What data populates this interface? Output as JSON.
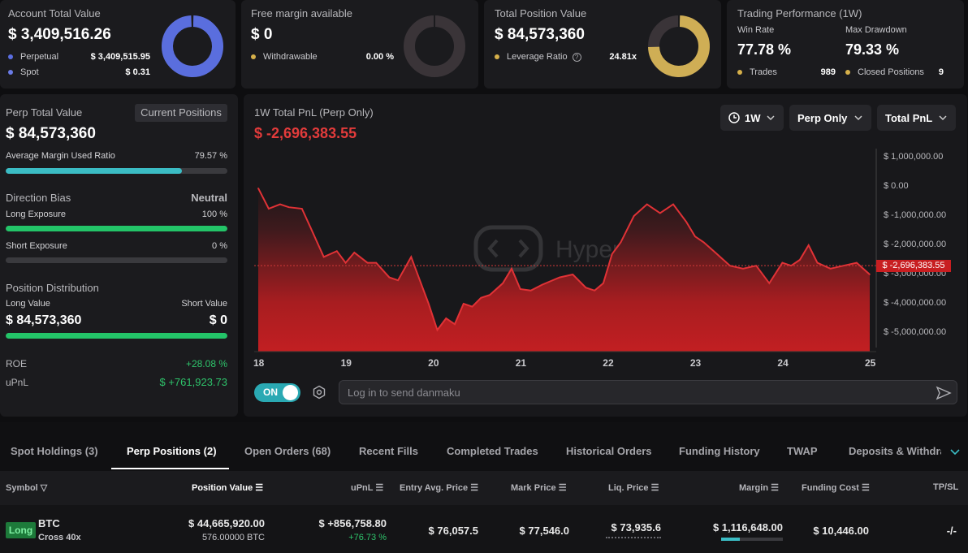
{
  "cards": {
    "account": {
      "title": "Account Total Value",
      "value": "$ 3,409,516.26",
      "rows": [
        {
          "label": "Perpetual",
          "value": "$ 3,409,515.95",
          "color": "#5b6ee1"
        },
        {
          "label": "Spot",
          "value": "$ 0.31",
          "color": "#6a7be6"
        }
      ],
      "donut_fraction": 1.0,
      "donut_color": "#5a6ede"
    },
    "margin": {
      "title": "Free margin available",
      "value": "$ 0",
      "row_label": "Withdrawable",
      "row_value": "0.00 %",
      "dot_color": "#d6b04a",
      "donut_fraction": 0.0,
      "donut_color": "#d6b04a"
    },
    "position": {
      "title": "Total Position Value",
      "value": "$ 84,573,360",
      "row_label": "Leverage Ratio",
      "row_icon": "help-icon",
      "row_value": "24.81x",
      "dot_color": "#d6b04a",
      "donut_fraction": 0.75,
      "donut_color": "#cfae55"
    },
    "performance": {
      "title": "Trading Performance (1W)",
      "win_rate_label": "Win Rate",
      "win_rate": "77.78 %",
      "drawdown_label": "Max Drawdown",
      "drawdown": "79.33 %",
      "trades_label": "Trades",
      "trades": "989",
      "closed_label": "Closed Positions",
      "closed": "9",
      "dot_color": "#d6b04a"
    }
  },
  "left": {
    "perp_title": "Perp Total Value",
    "positions_button": "Current Positions",
    "perp_value": "$ 84,573,360",
    "margin_ratio_label": "Average Margin Used Ratio",
    "margin_ratio_value": "79.57 %",
    "margin_ratio_fraction": 0.7957,
    "direction_title": "Direction Bias",
    "direction_value": "Neutral",
    "long_label": "Long Exposure",
    "long_value": "100 %",
    "long_fraction": 1.0,
    "short_label": "Short Exposure",
    "short_value": "0 %",
    "short_fraction": 0.0,
    "distribution_title": "Position Distribution",
    "long_value_label": "Long Value",
    "short_value_label": "Short Value",
    "long_amount": "$ 84,573,360",
    "short_amount": "$ 0",
    "distribution_long_fraction": 1.0,
    "roe_label": "ROE",
    "roe_value": "+28.08 %",
    "upnl_label": "uPnL",
    "upnl_value": "$ +761,923.73",
    "green": "#23c468",
    "teal": "#3bbcc4"
  },
  "chart_panel": {
    "title": "1W Total PnL (Perp Only)",
    "value": "$ -2,696,383.55",
    "period": "1W",
    "period_icon": "clock-icon",
    "scope": "Perp Only",
    "metric": "Total PnL",
    "watermark": "Hyperbot",
    "toggle": "ON",
    "danmaku_placeholder": "Log in to send danmaku",
    "settings_icon": "hexagon-gear-icon",
    "send_icon": "send-icon",
    "current_label": "$ -2,696,383.55"
  },
  "chart_data": {
    "type": "area",
    "x_ticks": [
      "18",
      "19",
      "20",
      "21",
      "22",
      "23",
      "24",
      "25"
    ],
    "y_ticks": [
      "$ 1,000,000.00",
      "$ 0.00",
      "$ -1,000,000.00",
      "$ -2,000,000.00",
      "$ -3,000,000.00",
      "$ -4,000,000.00",
      "$ -5,000,000.00"
    ],
    "ylim": [
      -5000000,
      1000000
    ],
    "current_value": -2696383.55,
    "series": [
      {
        "x": [
          18.0,
          18.12,
          18.25,
          18.35,
          18.5,
          18.6,
          18.75,
          18.9,
          19.0,
          19.1,
          19.25,
          19.35,
          19.5,
          19.6,
          19.75,
          19.85,
          19.95,
          20.05,
          20.15,
          20.25,
          20.35,
          20.45,
          20.55,
          20.65,
          20.8,
          20.9,
          21.0,
          21.12,
          21.25,
          21.45,
          21.6,
          21.75,
          21.85,
          21.95,
          22.05,
          22.15,
          22.3,
          22.45,
          22.6,
          22.75,
          22.9,
          23.0,
          23.1,
          23.25,
          23.4,
          23.55,
          23.7,
          23.85,
          24.0,
          24.1,
          24.2,
          24.3,
          24.4,
          24.55,
          24.7,
          24.85,
          25.0
        ],
        "values": [
          -50000,
          -750000,
          -600000,
          -700000,
          -750000,
          -1400000,
          -2400000,
          -2200000,
          -2600000,
          -2250000,
          -2600000,
          -2600000,
          -3100000,
          -3200000,
          -2400000,
          -3200000,
          -4000000,
          -4900000,
          -4500000,
          -4700000,
          -4000000,
          -4100000,
          -3800000,
          -3700000,
          -3300000,
          -2800000,
          -3500000,
          -3550000,
          -3350000,
          -3100000,
          -3000000,
          -3450000,
          -3550000,
          -3300000,
          -2300000,
          -1900000,
          -1000000,
          -600000,
          -900000,
          -600000,
          -1200000,
          -1700000,
          -1900000,
          -2300000,
          -2700000,
          -2800000,
          -2700000,
          -3300000,
          -2600000,
          -2700000,
          -2500000,
          -2000000,
          -2600000,
          -2800000,
          -2700000,
          -2600000,
          -3000000
        ]
      }
    ],
    "grid": false
  },
  "tabs": [
    "Spot Holdings (3)",
    "Perp Positions (2)",
    "Open Orders (68)",
    "Recent Fills",
    "Completed Trades",
    "Historical Orders",
    "Funding History",
    "TWAP",
    "Deposits & Withdra"
  ],
  "active_tab": 1,
  "table": {
    "headers": {
      "symbol": "Symbol",
      "position_value": "Position Value",
      "upnl": "uPnL",
      "entry": "Entry Avg. Price",
      "mark": "Mark Price",
      "liq": "Liq. Price",
      "margin": "Margin",
      "funding": "Funding Cost",
      "tpsl": "TP/SL"
    },
    "rows": [
      {
        "side": "Long",
        "symbol": "BTC",
        "mode": "Cross 40x",
        "position_value": "$ 44,665,920.00",
        "size": "576.00000 BTC",
        "upnl": "$ +856,758.80",
        "upnl_pct": "+76.73 %",
        "entry": "$ 76,057.5",
        "mark": "$ 77,546.0",
        "liq": "$ 73,935.6",
        "margin": "$ 1,116,648.00",
        "margin_fraction": 0.3,
        "funding": "$ 10,446.00",
        "tpsl": "-/-"
      }
    ]
  }
}
